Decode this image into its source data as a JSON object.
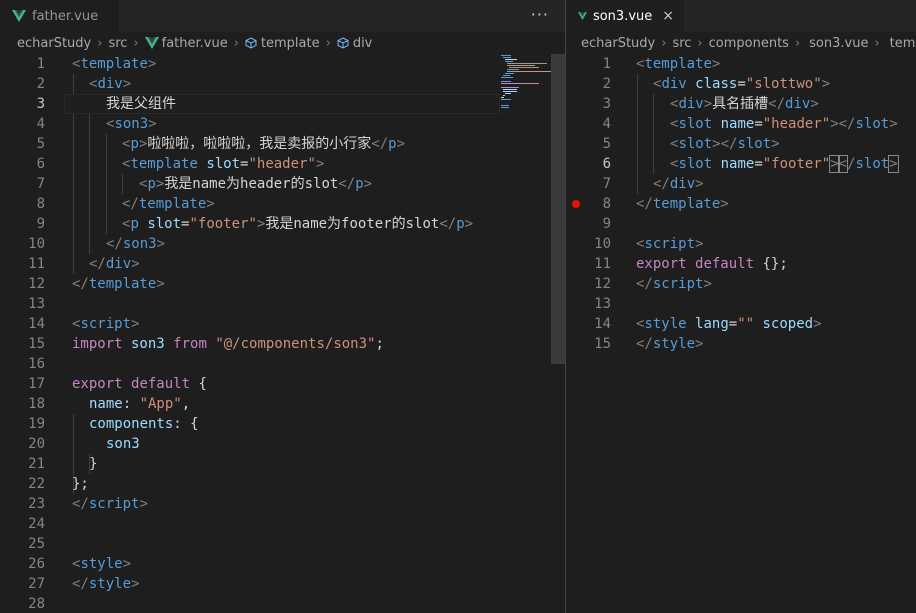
{
  "left": {
    "tab": {
      "label": "father.vue",
      "icon": "vue-icon"
    },
    "more_label": "···",
    "breadcrumb": [
      "echarStudy",
      "src",
      "father.vue",
      "template",
      "div"
    ],
    "lines": [
      {
        "n": "1"
      },
      {
        "n": "2"
      },
      {
        "n": "3"
      },
      {
        "n": "4"
      },
      {
        "n": "5"
      },
      {
        "n": "6"
      },
      {
        "n": "7"
      },
      {
        "n": "8"
      },
      {
        "n": "9"
      },
      {
        "n": "10"
      },
      {
        "n": "11"
      },
      {
        "n": "12"
      },
      {
        "n": "13"
      },
      {
        "n": "14"
      },
      {
        "n": "15"
      },
      {
        "n": "16"
      },
      {
        "n": "17"
      },
      {
        "n": "18"
      },
      {
        "n": "19"
      },
      {
        "n": "20"
      },
      {
        "n": "21"
      },
      {
        "n": "22"
      },
      {
        "n": "23"
      },
      {
        "n": "24"
      },
      {
        "n": "25"
      },
      {
        "n": "26"
      },
      {
        "n": "27"
      },
      {
        "n": "28"
      }
    ],
    "code": {
      "l1_a": "<",
      "l1_b": "template",
      "l1_c": ">",
      "l2_a": "<",
      "l2_b": "div",
      "l2_c": ">",
      "l3": "我是父组件",
      "l4_a": "<",
      "l4_b": "son3",
      "l4_c": ">",
      "l5_a": "<",
      "l5_b": "p",
      "l5_c": ">",
      "l5_d": "啦啦啦，啦啦啦，我是卖报的小行家",
      "l5_e": "</",
      "l5_f": "p",
      "l5_g": ">",
      "l6_a": "<",
      "l6_b": "template",
      "l6_c": " ",
      "l6_d": "slot",
      "l6_e": "=",
      "l6_f": "\"header\"",
      "l6_g": ">",
      "l7_a": "<",
      "l7_b": "p",
      "l7_c": ">",
      "l7_d": "我是name为header的slot",
      "l7_e": "</",
      "l7_f": "p",
      "l7_g": ">",
      "l8_a": "</",
      "l8_b": "template",
      "l8_c": ">",
      "l9_a": "<",
      "l9_b": "p",
      "l9_c": " ",
      "l9_d": "slot",
      "l9_e": "=",
      "l9_f": "\"footer\"",
      "l9_g": ">",
      "l9_h": "我是name为footer的slot",
      "l9_i": "</",
      "l9_j": "p",
      "l9_k": ">",
      "l10_a": "</",
      "l10_b": "son3",
      "l10_c": ">",
      "l11_a": "</",
      "l11_b": "div",
      "l11_c": ">",
      "l12_a": "</",
      "l12_b": "template",
      "l12_c": ">",
      "l14_a": "<",
      "l14_b": "script",
      "l14_c": ">",
      "l15_a": "import",
      "l15_b": " son3 ",
      "l15_c": "from",
      "l15_d": " ",
      "l15_e": "\"@/components/son3\"",
      "l15_f": ";",
      "l17_a": "export",
      "l17_b": " ",
      "l17_c": "default",
      "l17_d": " {",
      "l18_a": "name",
      "l18_b": ": ",
      "l18_c": "\"App\"",
      "l18_d": ",",
      "l19_a": "components",
      "l19_b": ": {",
      "l20": "son3",
      "l21": "}",
      "l22": "};",
      "l23_a": "</",
      "l23_b": "script",
      "l23_c": ">",
      "l26_a": "<",
      "l26_b": "style",
      "l26_c": ">",
      "l27_a": "</",
      "l27_b": "style",
      "l27_c": ">"
    }
  },
  "right": {
    "tab": {
      "label": "son3.vue",
      "icon": "vue-icon",
      "close": "×"
    },
    "breadcrumb": [
      "echarStudy",
      "src",
      "components",
      "son3.vue",
      "temp"
    ],
    "lines": [
      {
        "n": "1"
      },
      {
        "n": "2"
      },
      {
        "n": "3"
      },
      {
        "n": "4"
      },
      {
        "n": "5"
      },
      {
        "n": "6"
      },
      {
        "n": "7"
      },
      {
        "n": "8"
      },
      {
        "n": "9"
      },
      {
        "n": "10"
      },
      {
        "n": "11"
      },
      {
        "n": "12"
      },
      {
        "n": "13"
      },
      {
        "n": "14"
      },
      {
        "n": "15"
      }
    ],
    "code": {
      "r1_a": "<",
      "r1_b": "template",
      "r1_c": ">",
      "r2_a": "<",
      "r2_b": "div",
      "r2_c": " ",
      "r2_d": "class",
      "r2_e": "=",
      "r2_f": "\"slottwo\"",
      "r2_g": ">",
      "r3_a": "<",
      "r3_b": "div",
      "r3_c": ">",
      "r3_d": "具名插槽",
      "r3_e": "</",
      "r3_f": "div",
      "r3_g": ">",
      "r4_a": "<",
      "r4_b": "slot",
      "r4_c": " ",
      "r4_d": "name",
      "r4_e": "=",
      "r4_f": "\"header\"",
      "r4_g": "></",
      "r4_h": "slot",
      "r4_i": ">",
      "r5_a": "<",
      "r5_b": "slot",
      "r5_c": "></",
      "r5_d": "slot",
      "r5_e": ">",
      "r6_a": "<",
      "r6_b": "slot",
      "r6_c": " ",
      "r6_d": "name",
      "r6_e": "=",
      "r6_f": "\"footer\"",
      "r6_g": ">",
      "r6_h": "<",
      "r6_i": "/",
      "r6_j": "slot",
      "r6_k": ">",
      "r7_a": "</",
      "r7_b": "div",
      "r7_c": ">",
      "r8_a": "</",
      "r8_b": "template",
      "r8_c": ">",
      "r10_a": "<",
      "r10_b": "script",
      "r10_c": ">",
      "r11_a": "export",
      "r11_b": " ",
      "r11_c": "default",
      "r11_d": " {};",
      "r12_a": "</",
      "r12_b": "script",
      "r12_c": ">",
      "r14_a": "<",
      "r14_b": "style",
      "r14_c": " ",
      "r14_d": "lang",
      "r14_e": "=",
      "r14_f": "\"\"",
      "r14_g": " ",
      "r14_h": "scoped",
      "r14_i": ">",
      "r15_a": "</",
      "r15_b": "style",
      "r15_c": ">"
    }
  },
  "colors": {
    "tag": "#569cd6",
    "attr": "#9cdcfe",
    "string": "#ce9178",
    "keyword": "#c586c0",
    "text": "#d4d4d4",
    "bracket": "#808080",
    "breakpoint": "#e51400",
    "vue_green": "#41b883"
  }
}
